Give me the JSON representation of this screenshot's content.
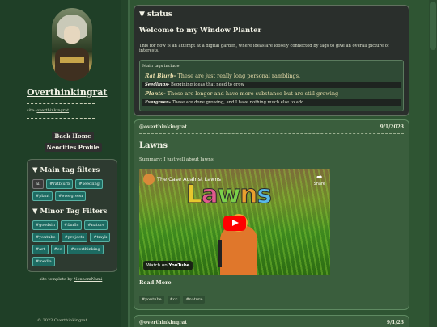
{
  "sidebar": {
    "site_title": "Overthinkingrat",
    "site_prefix": "site: ",
    "site_link": "overthinkingrat",
    "nav": [
      "Back Home",
      "Neocities Profile"
    ],
    "main_tag_heading": "▼ Main tag filters",
    "main_tags": [
      "all",
      "#ratblurb",
      "#seedling",
      "#plant",
      "#evergreen"
    ],
    "minor_tag_heading": "▼ Minor Tag Filters",
    "minor_tags": [
      "#goodsin",
      "#fanfic",
      "#nature",
      "#youtube",
      "#projects",
      "#tmyk",
      "#art",
      "#cc",
      "#overthinking",
      "#media"
    ],
    "credit_prefix": "site template by ",
    "credit_link": "NonnomNami",
    "copyright": "© 2023 Overthinkingrat"
  },
  "status": {
    "heading": "▼ status",
    "title": "Welcome to my Window Planter",
    "intro": "This for now is an attempt at a digital garden, where ideas are loosely connected by tags to give an overall picture of interests.",
    "tags_heading": "Main tags include",
    "rows": [
      {
        "name": "Rat Blurb-",
        "desc": " These are just really long personal ramblings."
      },
      {
        "name": "Seedlings-",
        "desc": " Beggining ideas that need to grow"
      },
      {
        "name": "Plants-",
        "desc": " These are longer and have more substance but are still growing"
      },
      {
        "name": "Evergreen-",
        "desc": " These are done growing, and I have nothing much else to add"
      }
    ]
  },
  "post1": {
    "author": "@overthinkingrat",
    "date": "9/1/2023",
    "title": "Lawns",
    "summary": "Summary: I just yell about lawns",
    "video_title": "The Case Against Lawns",
    "video_big": [
      "L",
      "a",
      "w",
      "n",
      "s"
    ],
    "share": "Share",
    "watch_on": "Watch on",
    "youtube": "YouTube",
    "read_more": "Read More",
    "tags": [
      "#youtube",
      "#cc",
      "#nature"
    ]
  },
  "post2": {
    "author": "@overthinkingrat",
    "date": "9/1/23"
  },
  "colors": {
    "background": "#24452b",
    "sidebar": "#1f3f27",
    "tag_fill": "#1d6b62",
    "accent_text": "#e6dbaa"
  }
}
